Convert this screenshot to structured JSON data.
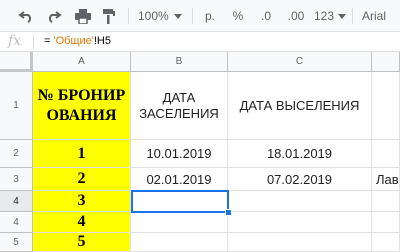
{
  "toolbar": {
    "zoom": "100%",
    "currency": "р.",
    "percent": "%",
    "decrease_decimals": ".0",
    "increase_decimals": ".00",
    "more_formats": "123",
    "font": "Arial"
  },
  "formula_bar": {
    "fx_label": "fx",
    "prefix": "= ",
    "sheet_ref": "'Общие'",
    "cell_ref": "!H5"
  },
  "columns": [
    "A",
    "B",
    "C"
  ],
  "rows": [
    "1",
    "2",
    "3",
    "4",
    "4",
    "5"
  ],
  "cells": {
    "A1": "№ БРОНИРОВАНИЯ",
    "B1": "ДАТА ЗАСЕЛЕНИЯ",
    "C1": "ДАТА ВЫСЕЛЕНИЯ",
    "A2": "1",
    "B2": "10.01.2019",
    "C2": "18.01.2019",
    "A3": "2",
    "B3": "02.01.2019",
    "C3": "07.02.2019",
    "D3": "Лав",
    "A4": "3",
    "A5": "4",
    "A6": "5"
  }
}
